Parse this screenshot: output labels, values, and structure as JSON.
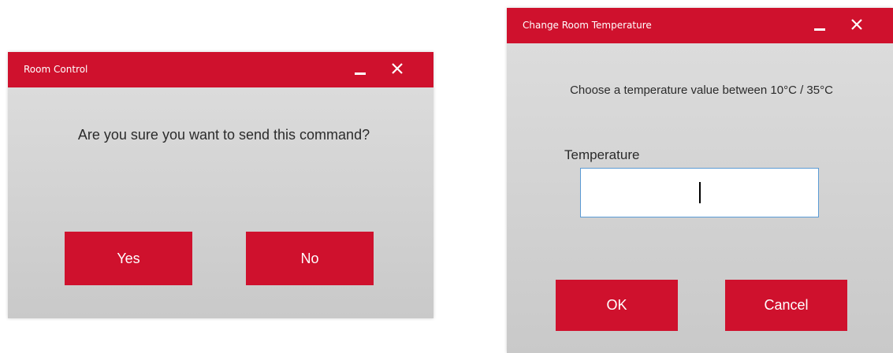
{
  "dialogs": {
    "room_control": {
      "title": "Room Control",
      "message": "Are you sure you want to send this command?",
      "buttons": {
        "yes": "Yes",
        "no": "No"
      }
    },
    "change_room_temperature": {
      "title": "Change Room Temperature",
      "message": "Choose a temperature value between 10°C / 35°C",
      "field_label": "Temperature",
      "field_value": "",
      "buttons": {
        "ok": "OK",
        "cancel": "Cancel"
      }
    }
  },
  "colors": {
    "accent": "#cf112d",
    "dialog_background_top": "#dedede",
    "dialog_background_bottom": "#c9c9c9",
    "input_border": "#5b9bd5"
  },
  "icons": {
    "minimize": "minimize-icon",
    "close": "close-icon"
  }
}
